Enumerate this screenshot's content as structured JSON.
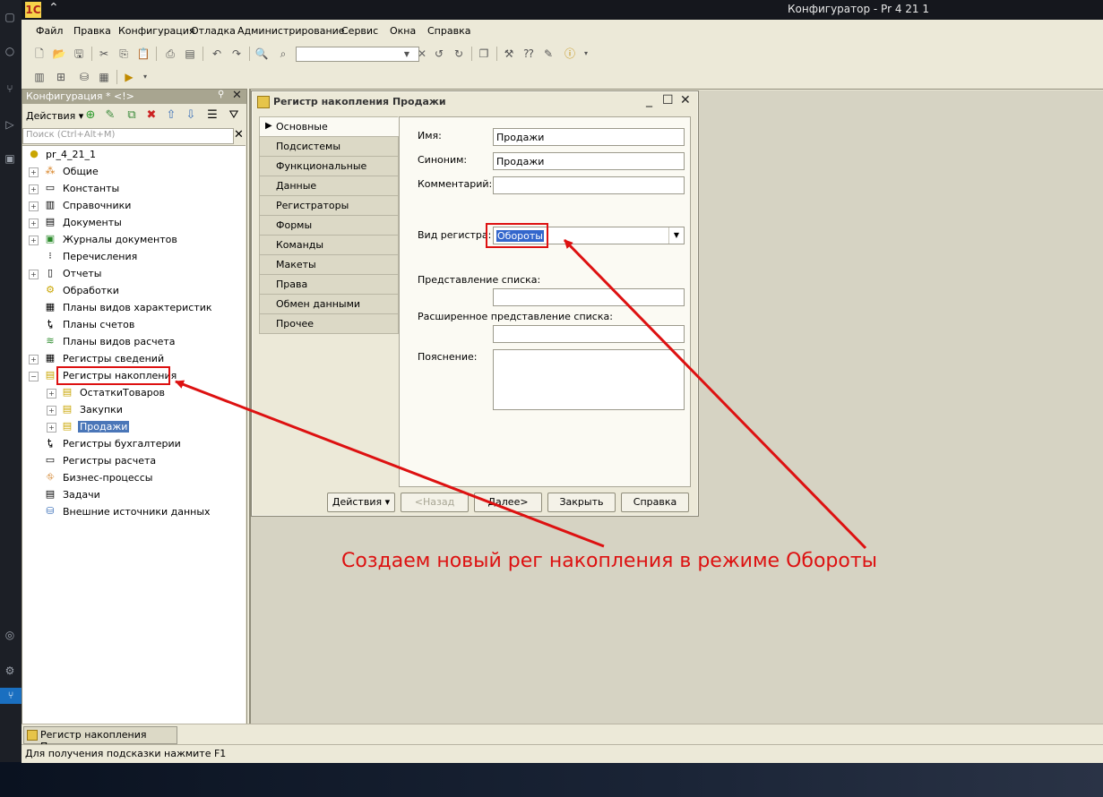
{
  "window": {
    "title": "Конфигуратор - Pr 4 21 1"
  },
  "menu": [
    "Файл",
    "Правка",
    "Конфигурация",
    "Отладка",
    "Администрирование",
    "Сервис",
    "Окна",
    "Справка"
  ],
  "config_panel": {
    "title": "Конфигурация * <!>",
    "actions_label": "Действия",
    "search_placeholder": "Поиск (Ctrl+Alt+M)",
    "tree": [
      {
        "label": "pr_4_21_1",
        "icon": "config-root-icon"
      },
      {
        "label": "Общие",
        "icon": "common-icon"
      },
      {
        "label": "Константы",
        "icon": "constants-icon"
      },
      {
        "label": "Справочники",
        "icon": "catalogs-icon"
      },
      {
        "label": "Документы",
        "icon": "documents-icon"
      },
      {
        "label": "Журналы документов",
        "icon": "journals-icon"
      },
      {
        "label": "Перечисления",
        "icon": "enums-icon"
      },
      {
        "label": "Отчеты",
        "icon": "reports-icon"
      },
      {
        "label": "Обработки",
        "icon": "dataprocessors-icon"
      },
      {
        "label": "Планы видов характеристик",
        "icon": "chart-of-characteristics-icon"
      },
      {
        "label": "Планы счетов",
        "icon": "chart-of-accounts-icon"
      },
      {
        "label": "Планы видов расчета",
        "icon": "chart-of-calc-icon"
      },
      {
        "label": "Регистры сведений",
        "icon": "info-registers-icon"
      },
      {
        "label": "Регистры накопления",
        "icon": "accum-registers-icon"
      },
      {
        "label": "ОстаткиТоваров",
        "icon": "register-icon"
      },
      {
        "label": "Закупки",
        "icon": "register-icon"
      },
      {
        "label": "Продажи",
        "icon": "register-icon"
      },
      {
        "label": "Регистры бухгалтерии",
        "icon": "acc-registers-icon"
      },
      {
        "label": "Регистры расчета",
        "icon": "calc-registers-icon"
      },
      {
        "label": "Бизнес-процессы",
        "icon": "business-process-icon"
      },
      {
        "label": "Задачи",
        "icon": "tasks-icon"
      },
      {
        "label": "Внешние источники данных",
        "icon": "external-sources-icon"
      }
    ]
  },
  "dialog": {
    "title": "Регистр накопления Продажи",
    "tabs": [
      "Основные",
      "Подсистемы",
      "Функциональные опции",
      "Данные",
      "Регистраторы",
      "Формы",
      "Команды",
      "Макеты",
      "Права",
      "Обмен данными",
      "Прочее"
    ],
    "fields": {
      "name_label": "Имя:",
      "name_value": "Продажи",
      "synonym_label": "Синоним:",
      "synonym_value": "Продажи",
      "comment_label": "Комментарий:",
      "comment_value": "",
      "kind_label": "Вид регистра:",
      "kind_value": "Обороты",
      "list_repr_label": "Представление списка:",
      "list_repr_value": "",
      "ext_list_repr_label": "Расширенное представление списка:",
      "ext_list_repr_value": "",
      "explanation_label": "Пояснение:",
      "explanation_value": ""
    },
    "buttons": {
      "actions": "Действия",
      "back": "<Назад",
      "next": "Далее>",
      "close": "Закрыть",
      "help": "Справка"
    }
  },
  "taskbar": {
    "item": "Регистр накопления Продажи"
  },
  "status": "Для получения подсказки нажмите F1",
  "annotation": {
    "text": "Создаем новый рег накопления в режиме Обороты",
    "color": "#dd1111"
  }
}
